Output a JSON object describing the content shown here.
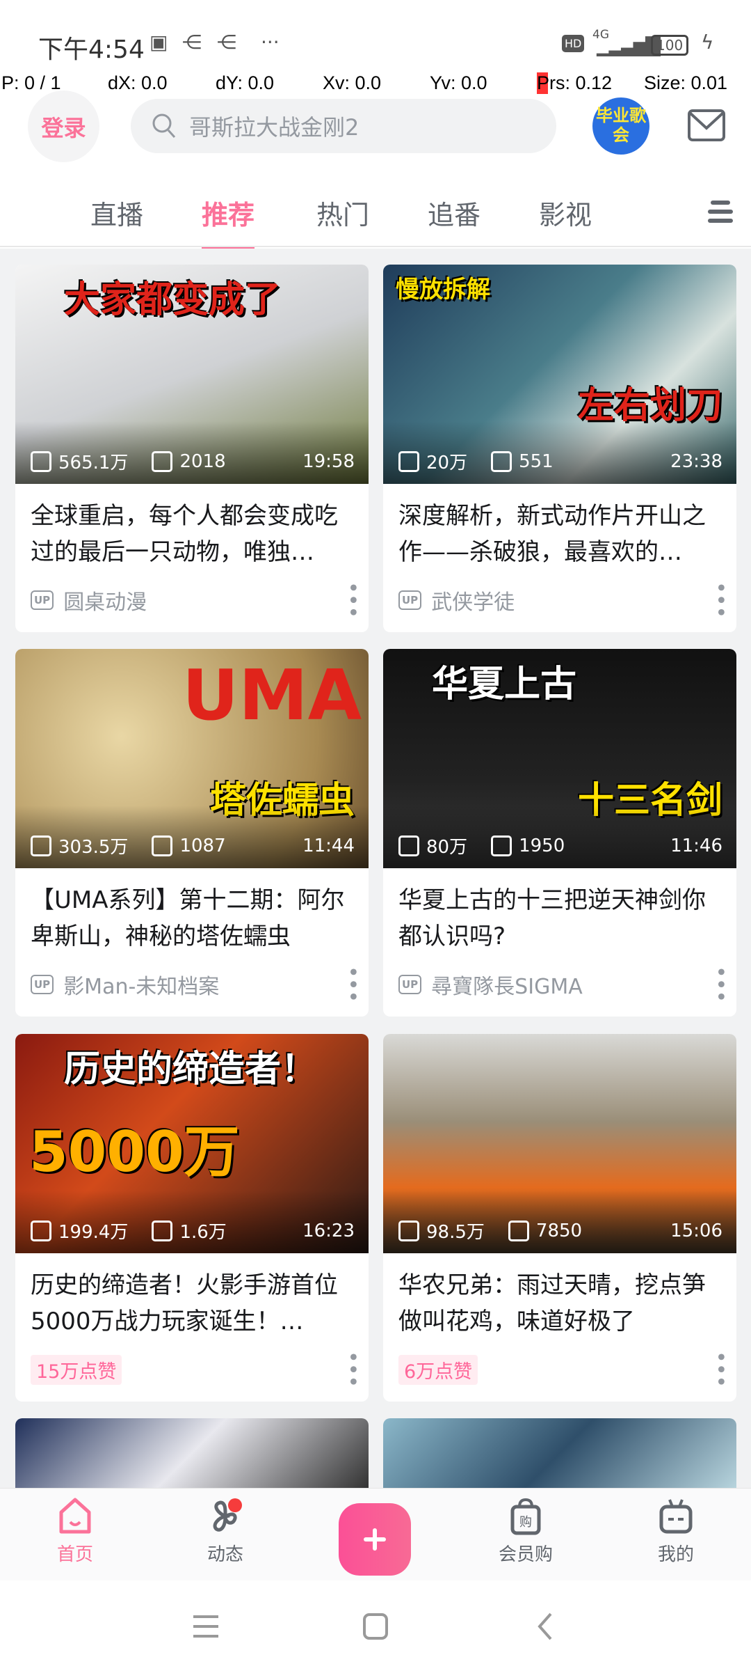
{
  "status_bar": {
    "time": "下午4:54",
    "network": "4G",
    "battery": "100",
    "hd": "HD",
    "more": "···"
  },
  "debug": {
    "p": "P: 0 / 1",
    "dx": "dX: 0.0",
    "dy": "dY: 0.0",
    "xv": "Xv: 0.0",
    "yv": "Yv: 0.0",
    "prs": "Prs: 0.12",
    "size": "Size: 0.01"
  },
  "header": {
    "login": "登录",
    "search_placeholder": "哥斯拉大战金刚2",
    "avatar_text": "毕业歌会"
  },
  "tabs": [
    {
      "label": "直播"
    },
    {
      "label": "推荐",
      "active": true
    },
    {
      "label": "热门"
    },
    {
      "label": "追番"
    },
    {
      "label": "影视"
    }
  ],
  "cards": [
    {
      "title": "全球重启，每个人都会变成吃过的最后一只动物，唯独…",
      "views": "565.1万",
      "danmaku": "2018",
      "duration": "19:58",
      "author": "圆桌动漫",
      "thumb_caption": "大家都变成了",
      "caption_color": "#e0241b",
      "bg": "linear-gradient(160deg,#f4f4f4 0%,#cfd1d4 50%,#6f7a3c 100%)"
    },
    {
      "title": "深度解析，新式动作片开山之作——杀破狼，最喜欢的…",
      "views": "20万",
      "danmaku": "551",
      "duration": "23:38",
      "author": "武侠学徒",
      "thumb_caption": "慢放拆解",
      "caption_color": "#ffe100",
      "thumb_caption2": "左右划刀",
      "caption2_color": "#e0241b",
      "bg": "linear-gradient(135deg,#1f3c5a 0%,#4a7d8a 45%,#d8e2de 70%,#3b6a6d 100%)"
    },
    {
      "title": "【UMA系列】第十二期：阿尔卑斯山，神秘的塔佐蠕虫",
      "views": "303.5万",
      "danmaku": "1087",
      "duration": "11:44",
      "author": "影Man-未知档案",
      "thumb_caption": "UMA",
      "caption_color": "#e0241b",
      "thumb_caption2": "塔佐蠕虫",
      "caption2_color": "#ffe100",
      "bg": "radial-gradient(circle at 30% 40%,#e9d7a5,#a88a52 70%,#6b5230)"
    },
    {
      "title": "华夏上古的十三把逆天神剑你都认识吗?",
      "views": "80万",
      "danmaku": "1950",
      "duration": "11:46",
      "author": "尋寶隊長SIGMA",
      "thumb_caption": "华夏上古",
      "caption_color": "#ffffff",
      "thumb_caption2": "十三名剑",
      "caption2_color": "#ffe100",
      "bg": "linear-gradient(180deg,#111 0%,#222 60%,#3a3a3a 100%)"
    },
    {
      "title": "历史的缔造者！火影手游首位5000万战力玩家诞生！…",
      "views": "199.4万",
      "danmaku": "1.6万",
      "duration": "16:23",
      "likes": "15万点赞",
      "thumb_caption": "历史的缔造者！",
      "caption_color": "#ffffff",
      "thumb_caption2": "5000万",
      "caption2_color": "#ffb000",
      "bg": "linear-gradient(135deg,#8a1a10 0%,#d24a1a 40%,#2a1a15 100%)"
    },
    {
      "title": "华农兄弟：雨过天晴，挖点笋做叫花鸡，味道好极了",
      "views": "98.5万",
      "danmaku": "7850",
      "duration": "15:06",
      "likes": "6万点赞",
      "bg": "linear-gradient(180deg,#d9d9d6 0%,#9a8e78 40%,#e46b1e 70%,#4a3b2a 100%)"
    },
    {
      "bg": "linear-gradient(135deg,#20305a,#e8e8ee 50%,#333)"
    },
    {
      "bg": "linear-gradient(135deg,#8bb7c9,#2f4f6a 50%,#b7d4dd)"
    }
  ],
  "bottom_nav": [
    {
      "label": "首页",
      "active": true
    },
    {
      "label": "动态"
    },
    {
      "label": "会员购"
    },
    {
      "label": "我的"
    }
  ],
  "colors": {
    "accent": "#fb7299",
    "feed_bg": "#f1f2f3"
  }
}
